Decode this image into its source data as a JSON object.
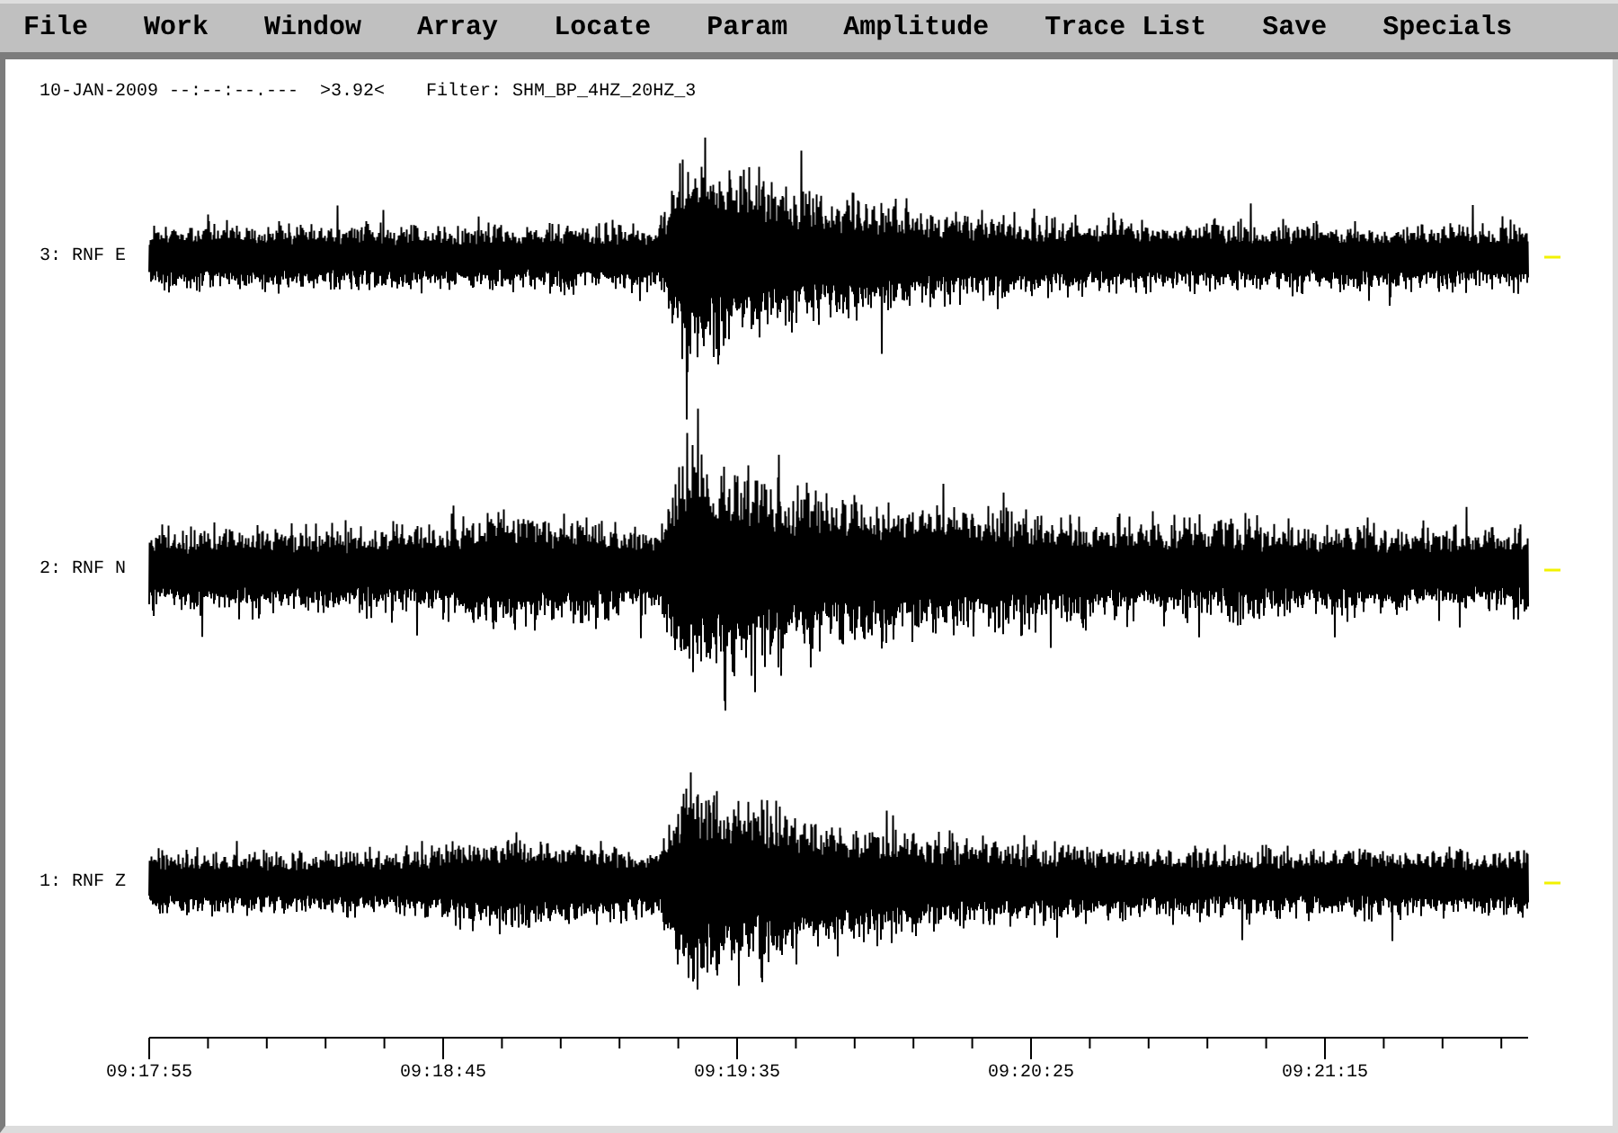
{
  "menu_bar": {
    "items": [
      "File",
      "Work",
      "Window",
      "Array",
      "Locate",
      "Param",
      "Amplitude",
      "Trace List",
      "Save",
      "Specials"
    ]
  },
  "status_line": {
    "date_time": "10-JAN-2009 --:--:--.---",
    "amplitude": ">3.92<",
    "filter": "Filter: SHM_BP_4HZ_20HZ_3"
  },
  "traces": [
    {
      "label": "3: RNF E"
    },
    {
      "label": "2: RNF N"
    },
    {
      "label": "1: RNF Z"
    }
  ],
  "time_axis": {
    "tick_labels": [
      "09:17:55",
      "09:18:45",
      "09:19:35",
      "09:20:25",
      "09:21:15"
    ]
  }
}
